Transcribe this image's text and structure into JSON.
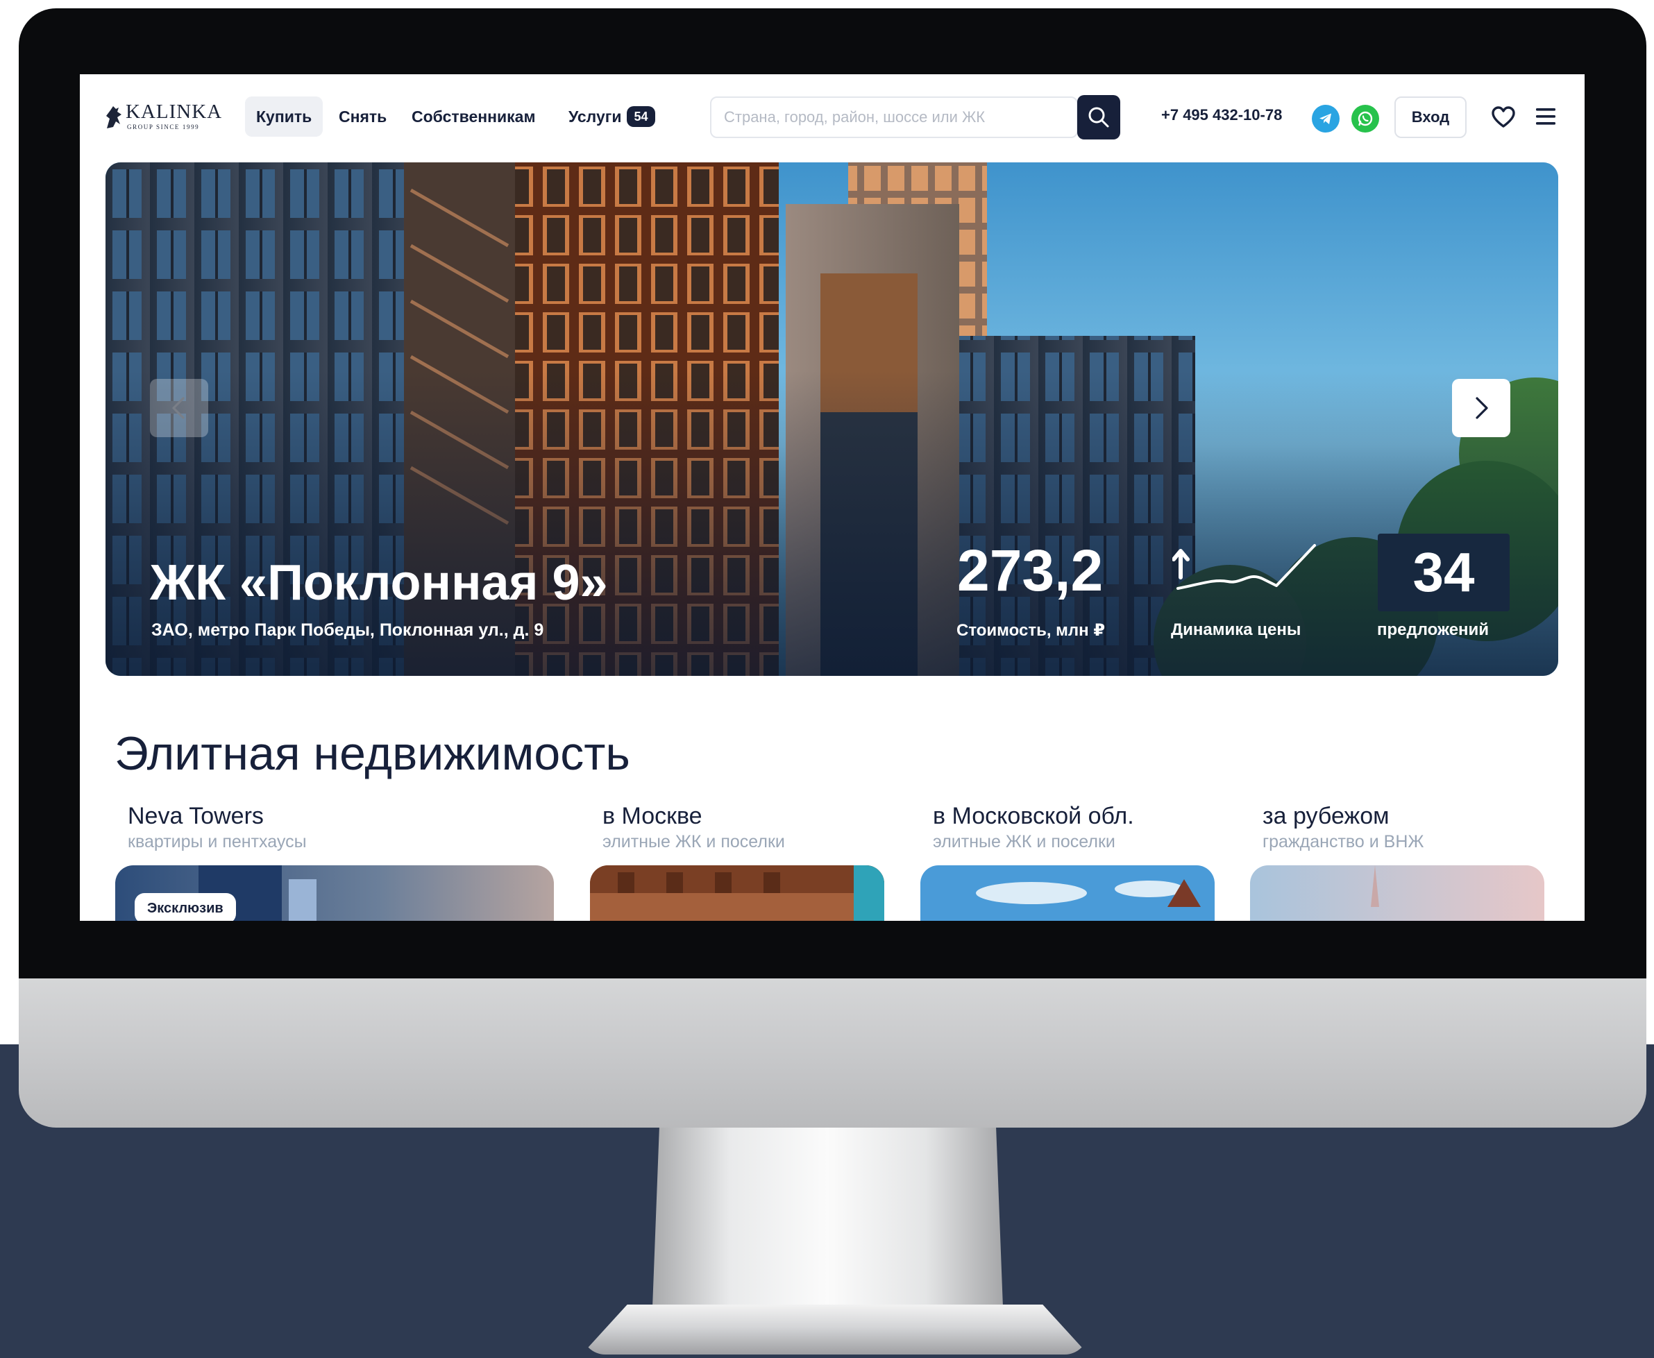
{
  "header": {
    "logo_name": "KALINKA",
    "logo_sub": "GROUP SINCE 1999",
    "nav": [
      {
        "label": "Купить"
      },
      {
        "label": "Снять"
      },
      {
        "label": "Собственникам"
      },
      {
        "label": "Услуги",
        "badge": "54"
      }
    ],
    "search_placeholder": "Страна, город, район, шоссе или ЖК",
    "phone": "+7 495 432-10-78",
    "login_label": "Вход"
  },
  "hero": {
    "title": "ЖК «Поклонная 9»",
    "address": "ЗАО, метро Парк Победы, Поклонная ул., д. 9",
    "price_value": "273,2",
    "price_label": "Стоимость, млн ₽",
    "trend_label": "Динамика цены",
    "offers_count": "34",
    "offers_label": "предложений"
  },
  "section": {
    "title": "Элитная недвижимость",
    "cards": [
      {
        "title": "Neva Towers",
        "subtitle": "квартиры и пентхаусы",
        "chip": "Эксклюзив"
      },
      {
        "title": "в Москве",
        "subtitle": "элитные ЖК и поселки"
      },
      {
        "title": "в Московской обл.",
        "subtitle": "элитные ЖК и поселки"
      },
      {
        "title": "за рубежом",
        "subtitle": "гражданство и ВНЖ"
      }
    ]
  },
  "colors": {
    "backdrop": "#2e3a51",
    "brand_dark": "#17203a",
    "telegram": "#2aa4e2",
    "whatsapp": "#27c24c",
    "muted_text": "#9aa6b6"
  },
  "icons": [
    "logo-horse-icon",
    "search-icon",
    "telegram-icon",
    "whatsapp-icon",
    "heart-icon",
    "menu-icon",
    "chevron-left-icon",
    "chevron-right-icon",
    "trend-up-icon"
  ]
}
